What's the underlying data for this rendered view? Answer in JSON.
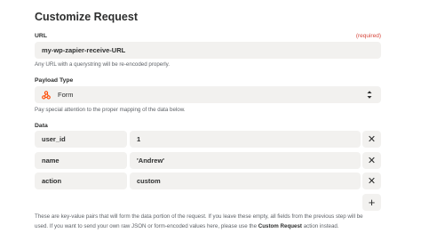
{
  "page": {
    "title": "Customize Request"
  },
  "url_field": {
    "label": "URL",
    "required": "(required)",
    "value": "my-wp-zapier-receive-URL",
    "help": "Any URL with a querystring will be re-encoded properly."
  },
  "payload_type": {
    "label": "Payload Type",
    "value": "Form",
    "help": "Pay special attention to the proper mapping of the data below."
  },
  "data_section": {
    "label": "Data",
    "rows": [
      {
        "key": "user_id",
        "value": "1"
      },
      {
        "key": "name",
        "value": "'Andrew'"
      },
      {
        "key": "action",
        "value": "custom"
      }
    ],
    "remove_glyph": "✕",
    "add_glyph": "+"
  },
  "footer": {
    "line1": "These are key-value pairs that will form the data portion of the request. If you leave these empty, all fields from the previous step will be",
    "line2_prefix": "used. If you want to send your own raw JSON or form-encoded values here, please use the",
    "line2_bold": "Custom Request",
    "line2_suffix": "action instead."
  },
  "colors": {
    "accent": "#ff4a00",
    "required": "#d6463b",
    "field_bg": "#f2f1ef"
  }
}
